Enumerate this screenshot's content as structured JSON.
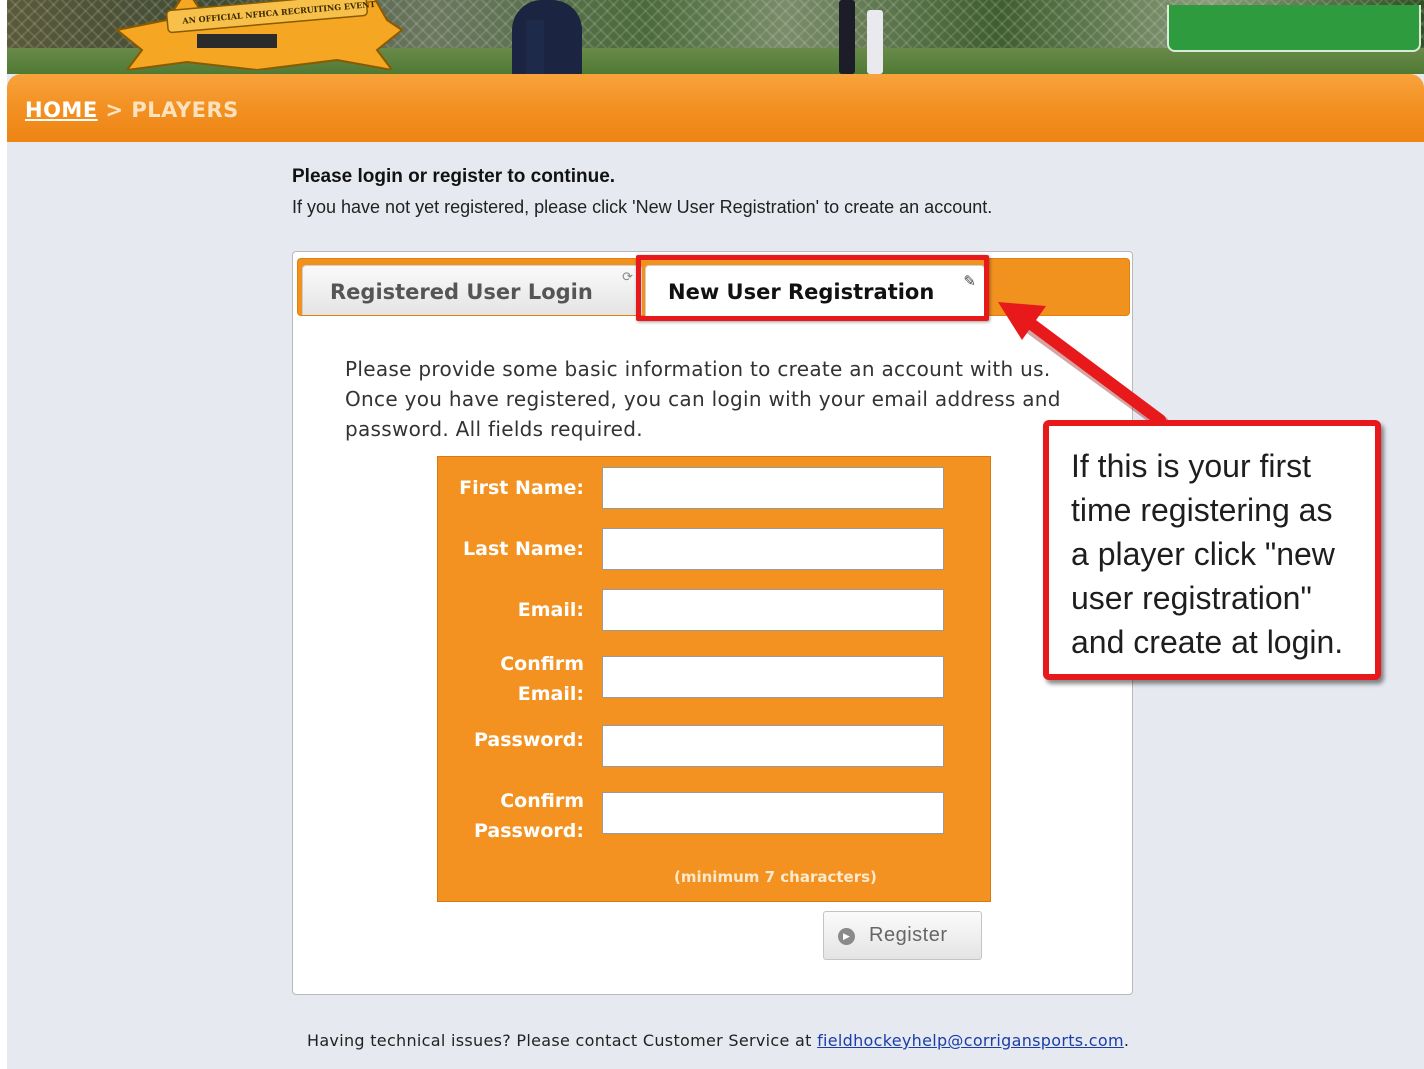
{
  "banner": {
    "badge_text": "AN OFFICIAL NFHCA RECRUITING EVENT"
  },
  "breadcrumb": {
    "home": "HOME",
    "separator": ">",
    "current": "PLAYERS"
  },
  "intro": {
    "title": "Please login or register to continue.",
    "text": "If you have not yet registered, please click 'New User Registration' to create an account."
  },
  "tabs": [
    {
      "label": "Registered User Login",
      "icon": "refresh-icon",
      "active": false
    },
    {
      "label": "New User Registration",
      "icon": "pencil-icon",
      "active": true
    }
  ],
  "registration": {
    "description": "Please provide some basic information to create an account with us. Once you have registered, you can login with your email address and password. All fields required.",
    "fields": [
      {
        "label_line1": "First Name:",
        "label_line2": "",
        "value": ""
      },
      {
        "label_line1": "Last Name:",
        "label_line2": "",
        "value": ""
      },
      {
        "label_line1": "Email:",
        "label_line2": "",
        "value": ""
      },
      {
        "label_line1": "Confirm",
        "label_line2": "Email:",
        "value": ""
      },
      {
        "label_line1": "Password:",
        "label_line2": "",
        "value": ""
      },
      {
        "label_line1": "Confirm",
        "label_line2": "Password:",
        "value": ""
      }
    ],
    "password_note": "(minimum 7 characters)",
    "register_button": "Register"
  },
  "callout": {
    "text_lines": [
      "If this is your first",
      "time registering as",
      "a player click \"new",
      "user registration\"",
      "and create at login."
    ],
    "border_color": "#e8191b"
  },
  "footer": {
    "text": "Having technical issues? Please contact Customer Service at",
    "email": "fieldhockeyhelp@corrigansports.com",
    "end": "."
  },
  "colors": {
    "accent_orange": "#f39220",
    "highlight_red": "#e8191b",
    "page_bg": "#e6e9f0"
  }
}
